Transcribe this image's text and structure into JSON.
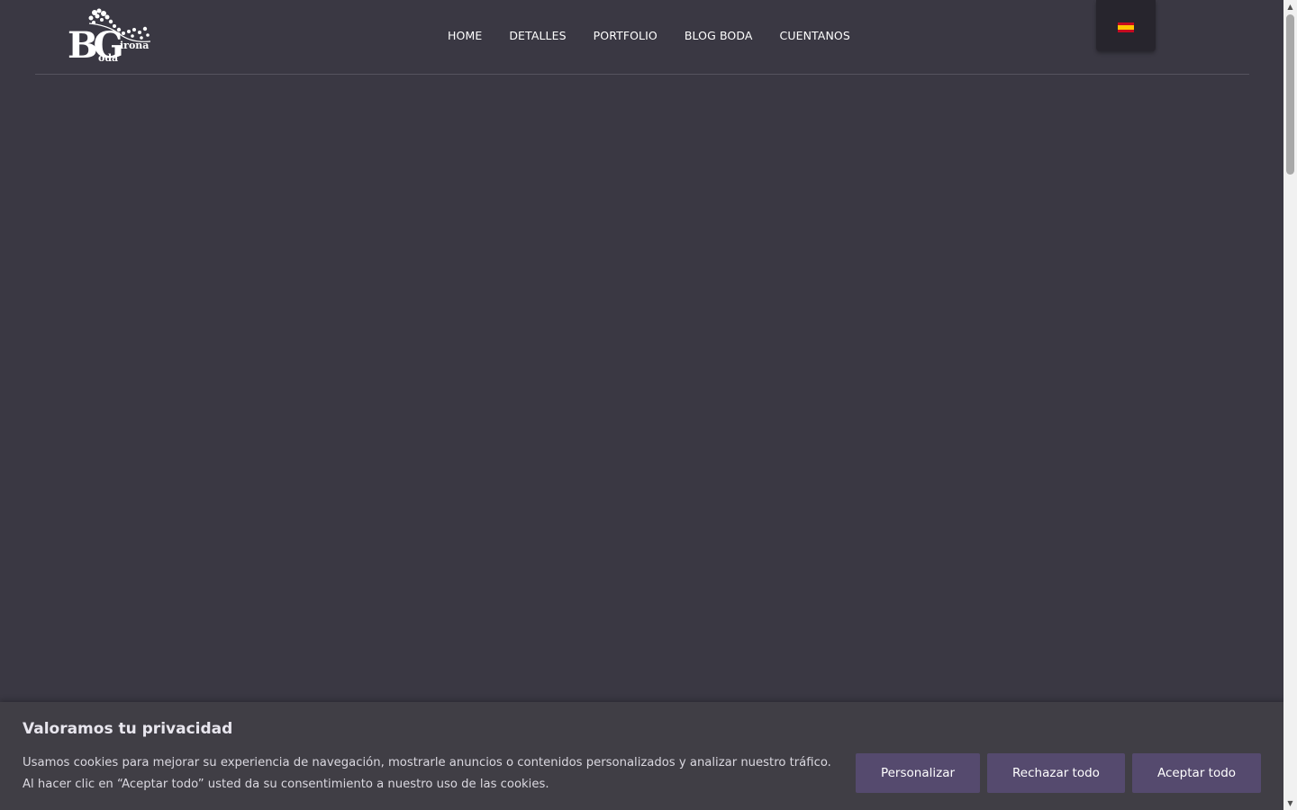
{
  "logo": {
    "alt": "Boda Girona",
    "letters": "BG",
    "word_top": "irona",
    "word_bottom": "oda"
  },
  "nav": {
    "items": [
      {
        "label": "HOME"
      },
      {
        "label": "DETALLES"
      },
      {
        "label": "PORTFOLIO"
      },
      {
        "label": "BLOG BODA"
      },
      {
        "label": "CUENTANOS"
      }
    ]
  },
  "language": {
    "flag": "spain-flag-icon"
  },
  "cookie_banner": {
    "title": "Valoramos tu privacidad",
    "text": "Usamos cookies para mejorar su experiencia de navegación, mostrarle anuncios o contenidos personalizados y analizar nuestro tráfico. Al hacer clic en “Aceptar todo” usted da su consentimiento a nuestro uso de las cookies.",
    "buttons": {
      "customize": "Personalizar",
      "reject": "Rechazar todo",
      "accept": "Aceptar todo"
    }
  },
  "colors": {
    "background": "#3a3843",
    "banner": "#403e45",
    "button": "#554a6e"
  }
}
